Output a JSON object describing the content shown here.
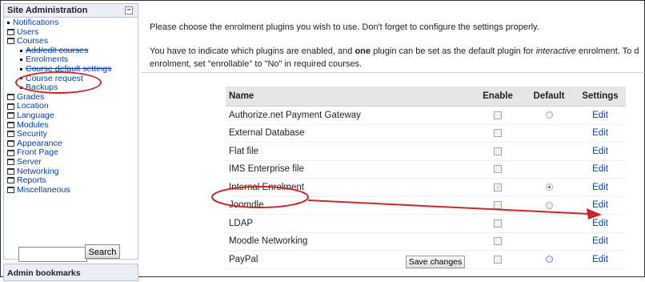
{
  "sidebar": {
    "title": "Site Administration",
    "items": [
      {
        "label": "Notifications",
        "type": "bullet",
        "indent": 0,
        "strike": false
      },
      {
        "label": "Users",
        "type": "folder",
        "indent": 0,
        "strike": false
      },
      {
        "label": "Courses",
        "type": "folder",
        "indent": 0,
        "strike": false
      },
      {
        "label": "Add/edit courses",
        "type": "bullet",
        "indent": 1,
        "strike": true
      },
      {
        "label": "Enrolments",
        "type": "bullet",
        "indent": 1,
        "strike": false
      },
      {
        "label": "Course default settings",
        "type": "bullet",
        "indent": 1,
        "strike": true
      },
      {
        "label": "Course request",
        "type": "bullet",
        "indent": 1,
        "strike": false
      },
      {
        "label": "Backups",
        "type": "bullet",
        "indent": 1,
        "strike": false
      },
      {
        "label": "Grades",
        "type": "folder",
        "indent": 0,
        "strike": false
      },
      {
        "label": "Location",
        "type": "folder",
        "indent": 0,
        "strike": false
      },
      {
        "label": "Language",
        "type": "folder",
        "indent": 0,
        "strike": false
      },
      {
        "label": "Modules",
        "type": "folder",
        "indent": 0,
        "strike": false
      },
      {
        "label": "Security",
        "type": "folder",
        "indent": 0,
        "strike": false
      },
      {
        "label": "Appearance",
        "type": "folder",
        "indent": 0,
        "strike": false
      },
      {
        "label": "Front Page",
        "type": "folder",
        "indent": 0,
        "strike": false
      },
      {
        "label": "Server",
        "type": "folder",
        "indent": 0,
        "strike": false
      },
      {
        "label": "Networking",
        "type": "folder",
        "indent": 0,
        "strike": false
      },
      {
        "label": "Reports",
        "type": "folder",
        "indent": 0,
        "strike": false
      },
      {
        "label": "Miscellaneous",
        "type": "folder",
        "indent": 0,
        "strike": false
      }
    ],
    "search_button": "Search",
    "bookmarks_title": "Admin bookmarks"
  },
  "main": {
    "intro_line1": "Please choose the enrolment plugins you wish to use. Don't forget to configure the settings properly.",
    "intro_line2_a": "You have to indicate which plugins are enabled, and ",
    "intro_line2_bold": "one",
    "intro_line2_b": " plugin can be set as the default plugin for ",
    "intro_line2_em": "interactive",
    "intro_line2_c": " enrolment. To d",
    "intro_line3": "enrolment, set \"enrollable\" to \"No\" in required courses.",
    "table_headers": [
      "Name",
      "Enable",
      "Default",
      "Settings"
    ],
    "plugins": [
      {
        "name": "Authorize.net Payment Gateway",
        "enabled": false,
        "default": "radio",
        "edit": "Edit"
      },
      {
        "name": "External Database",
        "enabled": false,
        "default": "none",
        "edit": "Edit"
      },
      {
        "name": "Flat file",
        "enabled": false,
        "default": "none",
        "edit": "Edit"
      },
      {
        "name": "IMS Enterprise file",
        "enabled": false,
        "default": "none",
        "edit": "Edit"
      },
      {
        "name": "Internal Enrolment",
        "enabled": true,
        "default": "selected",
        "edit": "Edit"
      },
      {
        "name": "Joomdle",
        "enabled": false,
        "default": "radio",
        "edit": "Edit"
      },
      {
        "name": "LDAP",
        "enabled": false,
        "default": "none",
        "edit": "Edit"
      },
      {
        "name": "Moodle Networking",
        "enabled": false,
        "default": "none",
        "edit": "Edit"
      },
      {
        "name": "PayPal",
        "enabled": false,
        "default": "radio-blue",
        "edit": "Edit"
      }
    ],
    "save_button": "Save changes"
  },
  "colors": {
    "link": "#0044aa",
    "annotation": "#c8282b",
    "header_bg": "#e6e6e6",
    "sidebar_header_bg": "#e9eef7"
  }
}
